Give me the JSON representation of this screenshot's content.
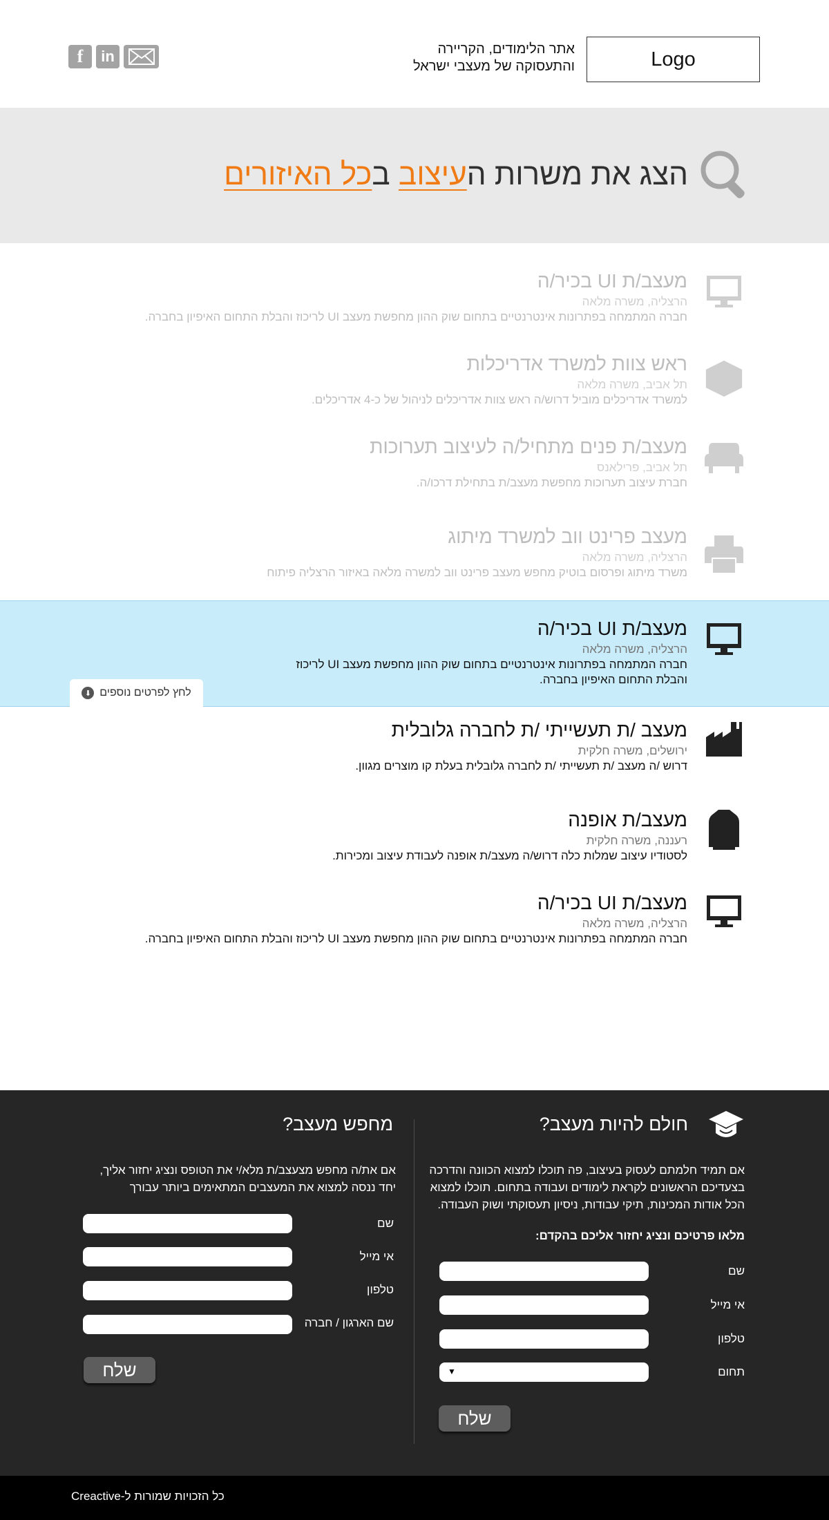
{
  "header": {
    "logo": "Logo",
    "tagline_line1": "אתר הלימודים, הקריירה",
    "tagline_line2": "והתעסוקה של מעצבי ישראל",
    "social": {
      "facebook": "f",
      "linkedin": "in"
    }
  },
  "hero": {
    "title_part1": "הצג את משרות ה",
    "title_hl1": "עיצוב",
    "title_part2": " ב",
    "title_hl2": "כל האיזורים",
    "accent_color": "#f07a14"
  },
  "jobs": [
    {
      "title": "מעצב/ת UI בכיר/ה",
      "meta": "הרצליה, משרה מלאה",
      "desc": "חברה המתמחה בפתרונות אינטרנטיים בתחום שוק ההון מחפשת מעצב UI לריכוז והבלת התחום האיפיון בחברה.",
      "icon": "monitor-icon",
      "state": "faded"
    },
    {
      "title": "ראש צוות למשרד אדריכלות",
      "meta": "תל אביב, משרה מלאה",
      "desc": "למשרד אדריכלים מוביל דרוש/ה ראש צוות אדריכלים לניהול של כ-4 אדריכלים.",
      "icon": "building-icon",
      "state": "faded"
    },
    {
      "title": "מעצב/ת פנים מתחיל/ה לעיצוב תערוכות",
      "meta": "תל אביב, פרילאנס",
      "desc": "חברת עיצוב תערוכות מחפשת מעצב/ת בתחילת דרכו/ה.",
      "icon": "armchair-icon",
      "state": "faded"
    },
    {
      "title": "מעצב פרינט ווב למשרד מיתוג",
      "meta": "הרצליה, משרה מלאה",
      "desc": "משרד מיתוג ופרסום בוטיק מחפש מעצב פרינט ווב למשרה מלאה באיזור הרצליה פיתוח",
      "icon": "printer-icon",
      "state": "faded"
    },
    {
      "title": "מעצב/ת UI בכיר/ה",
      "meta": "הרצליה, משרה מלאה",
      "desc": "חברה המתמחה בפתרונות אינטרנטיים בתחום שוק ההון מחפשת מעצב UI לריכוז והבלת התחום האיפיון בחברה.",
      "icon": "monitor-icon",
      "state": "active"
    },
    {
      "title": "מעצב /ת תעשייתי /ת לחברה גלובלית",
      "meta": "ירושלים, משרה חלקית",
      "desc": "דרוש /ה מעצב /ת תעשייתי /ת לחברה גלובלית בעלת קו מוצרים מגוון.",
      "icon": "factory-icon",
      "state": "normal"
    },
    {
      "title": "מעצב/ת אופנה",
      "meta": "רעננה, משרה חלקית",
      "desc": "לסטודיו עיצוב שמלות כלה דרוש/ה מעצב/ת אופנה לעבודת עיצוב ומכירות.",
      "icon": "suit-icon",
      "state": "normal"
    },
    {
      "title": "מעצב/ת UI בכיר/ה",
      "meta": "הרצליה, משרה מלאה",
      "desc": "חברה המתמחה בפתרונות אינטרנטיים בתחום שוק ההון מחפשת מעצב UI לריכוז והבלת התחום האיפיון בחברה.",
      "icon": "monitor-icon",
      "state": "normal"
    }
  ],
  "more_details": "לחץ לפרטים נוספים",
  "footer": {
    "dreamer": {
      "title": "חולם להיות מעצב?",
      "desc": "אם תמיד חלמתם לעסוק בעיצוב, פה תוכלו למצוא הכוונה והדרכה בצעדיכם הראשונים לקראת לימודים ועבודה בתחום. תוכלו למצוא הכל אודות המכינות, תיקי עבודות, ניסיון תעסוקתי ושוק העבודה.",
      "subtitle": "מלאו פרטיכם ונציג יחזור אליכם בהקדם:",
      "fields": [
        "שם",
        "אי מייל",
        "טלפון",
        "תחום"
      ],
      "send": "שלח"
    },
    "seeker": {
      "title": "מחפש מעצב?",
      "desc": "אם את/ה מחפש מצעצב/ת מלא/י את הטופס ונציג יחזור אליך, יחד ננסה למצוא את המעצבים המתאימים ביותר עבורך",
      "fields": [
        "שם",
        "אי מייל",
        "טלפון",
        "שם הארגון / חברה"
      ],
      "send": "שלח"
    },
    "copyright": "כל הזכויות שמורות ל-Creactive"
  }
}
